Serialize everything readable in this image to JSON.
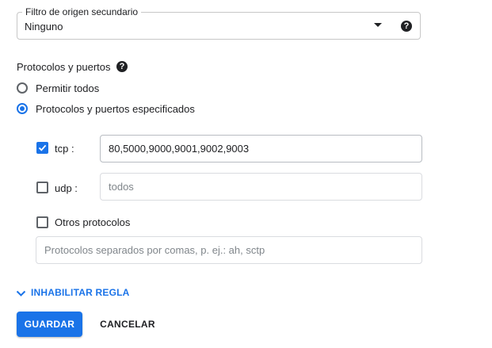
{
  "secondary_source_filter": {
    "label": "Filtro de origen secundario",
    "value": "Ninguno",
    "help_icon": "help-circle-icon"
  },
  "protocols": {
    "title": "Protocolos y puertos",
    "help_icon": "help-circle-icon",
    "options": [
      {
        "label": "Permitir todos",
        "selected": false
      },
      {
        "label": "Protocolos y puertos especificados",
        "selected": true
      }
    ],
    "tcp": {
      "label": "tcp :",
      "checked": true,
      "value": "80,5000,9000,9001,9002,9003"
    },
    "udp": {
      "label": "udp :",
      "checked": false,
      "placeholder": "todos"
    },
    "other": {
      "label": "Otros protocolos",
      "checked": false,
      "placeholder": "Protocolos separados por comas, p. ej.: ah, sctp"
    }
  },
  "toggle": {
    "label": "INHABILITAR REGLA",
    "icon": "chevron-down-icon"
  },
  "actions": {
    "save_label": "GUARDAR",
    "cancel_label": "CANCELAR"
  },
  "colors": {
    "accent": "#1a73e8",
    "text": "#202124",
    "border": "#dadce0"
  }
}
